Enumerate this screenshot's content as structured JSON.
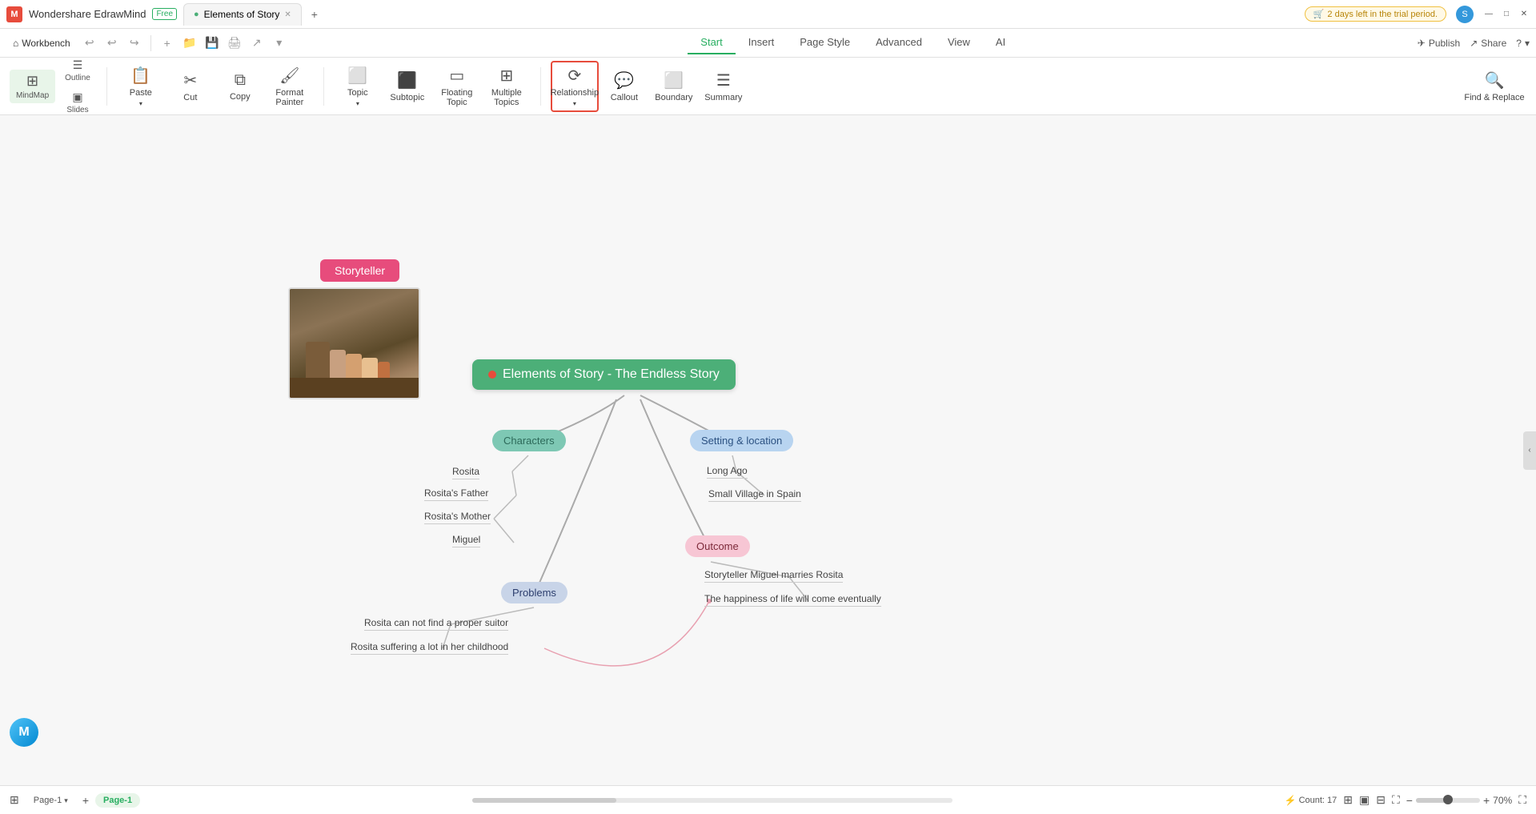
{
  "titlebar": {
    "app_name": "Wondershare EdrawMind",
    "app_badge": "Free",
    "tab1_label": "Elements of Story",
    "tab2_add": "+",
    "trial_text": "2 days left in the trial period.",
    "avatar_label": "S",
    "minimize": "—",
    "maximize": "□",
    "close": "✕"
  },
  "menubar": {
    "workbench": "Workbench",
    "tabs": [
      "Start",
      "Insert",
      "Page Style",
      "Advanced",
      "View",
      "AI"
    ],
    "active_tab": "Start",
    "publish": "Publish",
    "share": "Share",
    "help": "?"
  },
  "toolbar": {
    "view_mindmap": "MindMap",
    "view_outline": "Outline",
    "view_slides": "Slides",
    "paste": "Paste",
    "cut": "Cut",
    "copy": "Copy",
    "format_painter": "Format Painter",
    "topic": "Topic",
    "subtopic": "Subtopic",
    "floating_topic": "Floating Topic",
    "multiple_topics": "Multiple Topics",
    "relationship": "Relationship",
    "callout": "Callout",
    "boundary": "Boundary",
    "summary": "Summary",
    "find_replace": "Find & Replace"
  },
  "mindmap": {
    "main_node": "Elements of Story - The Endless Story",
    "storyteller": "Storyteller",
    "branches": {
      "characters": "Characters",
      "setting": "Setting & location",
      "outcome": "Outcome",
      "problems": "Problems"
    },
    "leaves": {
      "characters": [
        "Rosita",
        "Rosita's Father",
        "Rosita's Mother",
        "Miguel"
      ],
      "setting": [
        "Long Ago",
        "Small Village in Spain"
      ],
      "outcome": [
        "Storyteller Miguel marries Rosita",
        "The happiness of life will come eventually"
      ],
      "problems": [
        "Rosita can not find a proper suitor",
        "Rosita suffering a lot in her childhood"
      ]
    }
  },
  "statusbar": {
    "page_label": "Page-1",
    "active_page": "Page-1",
    "count_label": "Count: 17",
    "zoom": "70%"
  }
}
